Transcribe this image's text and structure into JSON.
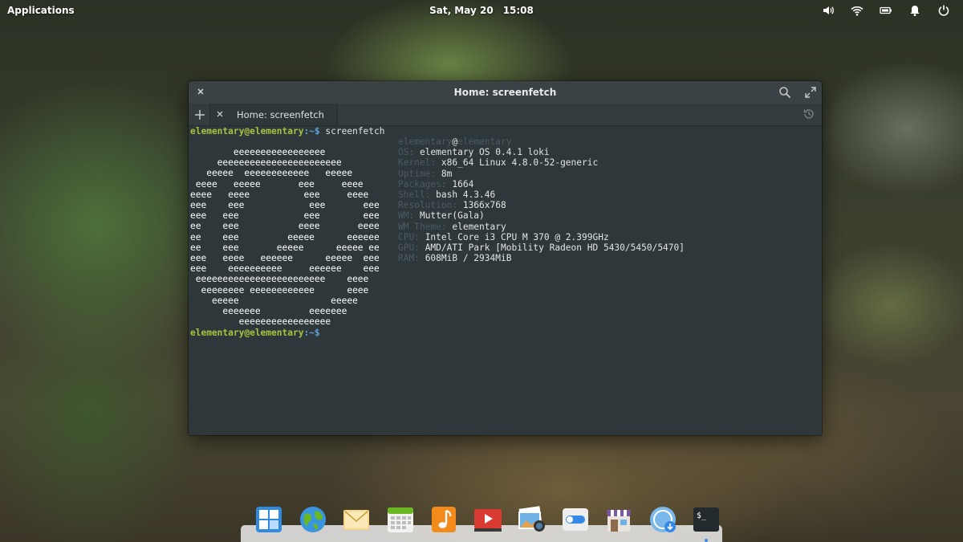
{
  "panel": {
    "applications_label": "Applications",
    "date": "Sat, May 20",
    "time": "15:08",
    "indicators": [
      "volume-icon",
      "wifi-icon",
      "battery-icon",
      "notifications-icon",
      "power-icon"
    ]
  },
  "terminal": {
    "title": "Home: screenfetch",
    "tab_label": "Home: screenfetch",
    "prompt_user": "elementary@elementary",
    "prompt_path": ":~$",
    "command": " screenfetch",
    "logo_lines": [
      "        eeeeeeeeeeeeeeeee",
      "     eeeeeeeeeeeeeeeeeeeeeee",
      "   eeeee  eeeeeeeeeeee   eeeee",
      " eeee   eeeee       eee     eeee",
      "eeee   eeee          eee     eeee",
      "eee    eee            eee       eee",
      "eee   eee            eee        eee",
      "ee    eee           eeee       eeee",
      "ee    eee         eeeee      eeeeee",
      "ee    eee       eeeee      eeeee ee",
      "eee   eeee   eeeeee      eeeee  eee",
      "eee    eeeeeeeeee     eeeeee    eee",
      " eeeeeeeeeeeeeeeeeeeeeeee    eeee",
      "  eeeeeeee eeeeeeeeeeee      eeee",
      "    eeeee                 eeeee",
      "      eeeeeee         eeeeeee",
      "         eeeeeeeeeeeeeeeee"
    ],
    "info_header_user": "elementary",
    "info_header_at": "@",
    "info_header_host": "elementary",
    "info": [
      {
        "key": "OS:",
        "value": " elementary OS 0.4.1 loki"
      },
      {
        "key": "Kernel:",
        "value": " x86_64 Linux 4.8.0-52-generic"
      },
      {
        "key": "Uptime:",
        "value": " 8m"
      },
      {
        "key": "Packages:",
        "value": " 1664"
      },
      {
        "key": "Shell:",
        "value": " bash 4.3.46"
      },
      {
        "key": "Resolution:",
        "value": " 1366x768"
      },
      {
        "key": "WM:",
        "value": " Mutter(Gala)"
      },
      {
        "key": "WM Theme:",
        "value": " elementary"
      },
      {
        "key": "CPU:",
        "value": " Intel Core i3 CPU M 370 @ 2.399GHz"
      },
      {
        "key": "GPU:",
        "value": " AMD/ATI Park [Mobility Radeon HD 5430/5450/5470]"
      },
      {
        "key": "RAM:",
        "value": " 608MiB / 2934MiB"
      }
    ]
  },
  "dock": {
    "items": [
      {
        "icon": "multitasking-view-icon"
      },
      {
        "icon": "web-browser-icon"
      },
      {
        "icon": "mail-icon"
      },
      {
        "icon": "calendar-icon"
      },
      {
        "icon": "music-icon"
      },
      {
        "icon": "videos-icon"
      },
      {
        "icon": "photos-icon"
      },
      {
        "icon": "system-settings-icon"
      },
      {
        "icon": "appcenter-icon"
      },
      {
        "icon": "software-updates-icon"
      },
      {
        "icon": "terminal-icon",
        "running": true
      }
    ]
  }
}
